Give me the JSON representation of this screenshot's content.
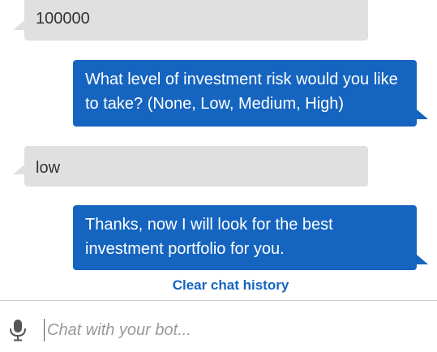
{
  "messages": [
    {
      "role": "user",
      "text": "100000"
    },
    {
      "role": "bot",
      "text": "What level of investment risk would you like to take? (None, Low, Medium, High)"
    },
    {
      "role": "user",
      "text": "low"
    },
    {
      "role": "bot",
      "text": "Thanks, now I will look for the best investment portfolio for you."
    }
  ],
  "clear_history_label": "Clear chat history",
  "input": {
    "placeholder": "Chat with your bot...",
    "value": ""
  },
  "colors": {
    "bot_bubble": "#1565c0",
    "user_bubble": "#e0e0e0",
    "link": "#1565c0"
  },
  "icons": {
    "mic": "microphone-icon"
  }
}
